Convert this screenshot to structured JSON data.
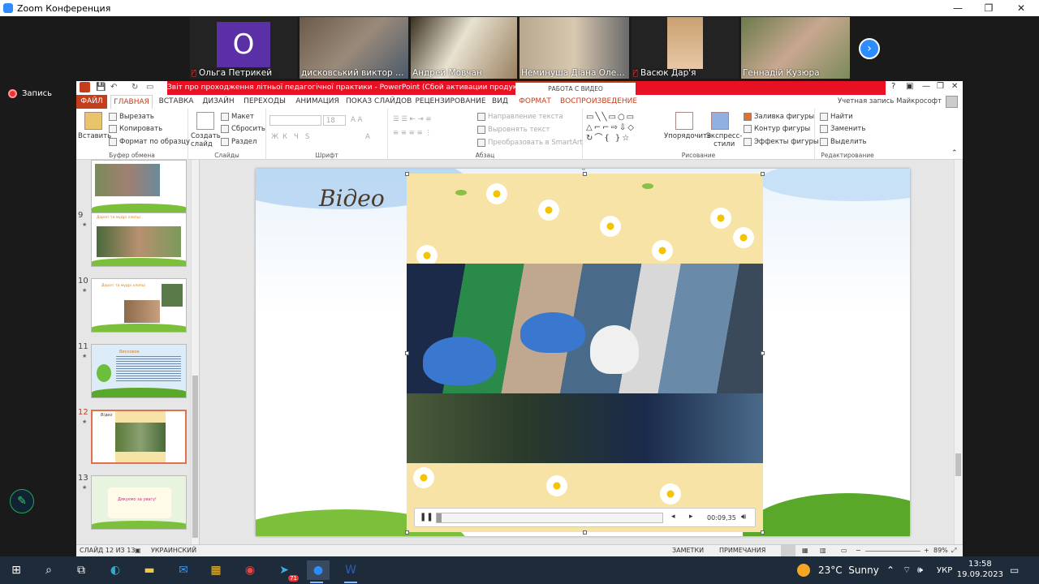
{
  "zoom": {
    "window_title": "Zoom Конференция",
    "recording_label": "Запись",
    "participants": [
      {
        "name": "Ольга Петрикей",
        "muted": true,
        "avatar_letter": "O"
      },
      {
        "name": "дисковський виктор ива...",
        "muted": false
      },
      {
        "name": "Андрей Мовчан",
        "muted": false
      },
      {
        "name": "Неминуша Діана Олегівна",
        "muted": false
      },
      {
        "name": "Васюк Дар'я",
        "muted": true
      },
      {
        "name": "Геннадій Кузюра",
        "muted": false
      }
    ]
  },
  "ppt": {
    "title": "Звіт про проходження літньої педагогічної  практики  -  PowerPoint (Сбой активации продукта)",
    "context_tab_group": "РАБОТА С ВИДЕО",
    "tabs": [
      "ФАЙЛ",
      "ГЛАВНАЯ",
      "ВСТАВКА",
      "ДИЗАЙН",
      "ПЕРЕХОДЫ",
      "АНИМАЦИЯ",
      "ПОКАЗ СЛАЙДОВ",
      "РЕЦЕНЗИРОВАНИЕ",
      "ВИД",
      "ФОРМАТ",
      "ВОСПРОИЗВЕДЕНИЕ"
    ],
    "account": "Учетная запись Майкрософт",
    "ribbon": {
      "clipboard": {
        "label": "Буфер обмена",
        "paste": "Вставить",
        "cut": "Вырезать",
        "copy": "Копировать",
        "format_painter": "Формат по образцу"
      },
      "slides": {
        "label": "Слайды",
        "new_slide": "Создать слайд",
        "layout": "Макет",
        "reset": "Сбросить",
        "section": "Раздел"
      },
      "font": {
        "label": "Шрифт",
        "size": "18",
        "bold": "Ж",
        "italic": "К",
        "underline": "Ч",
        "strike": "S"
      },
      "paragraph": {
        "label": "Абзац",
        "text_direction": "Направление текста",
        "align_text": "Выровнять текст",
        "smartart": "Преобразовать в SmartArt"
      },
      "drawing": {
        "label": "Рисование",
        "arrange": "Упорядочить",
        "quick_styles": "Экспресс-стили",
        "fill": "Заливка фигуры",
        "outline": "Контур фигуры",
        "effects": "Эффекты фигуры"
      },
      "editing": {
        "label": "Редактирование",
        "find": "Найти",
        "replace": "Заменить",
        "select": "Выделить"
      }
    },
    "thumbnails": [
      {
        "num": "",
        "title": ""
      },
      {
        "num": "9",
        "title": "Дорогі та мудрі хлопці"
      },
      {
        "num": "10",
        "title": "Дорогі та мудрі хлопці"
      },
      {
        "num": "11",
        "title": "Висновок"
      },
      {
        "num": "12",
        "title": "Відео"
      },
      {
        "num": "13",
        "title": "Дякуємо за увагу!"
      }
    ],
    "selected_slide": "12",
    "slide": {
      "title": "Відео",
      "video_time": "00:09,35",
      "video_progress": 0.02
    },
    "status": {
      "slide_info": "СЛАЙД 12 ИЗ 13",
      "language": "УКРАИНСКИЙ",
      "notes": "ЗАМЕТКИ",
      "comments": "ПРИМЕЧАНИЯ",
      "zoom": "89%"
    }
  },
  "taskbar": {
    "weather_temp": "23°C",
    "weather_text": "Sunny",
    "lang": "УКР",
    "time": "13:58",
    "date": "19.09.2023",
    "telegram_badge": "71"
  }
}
